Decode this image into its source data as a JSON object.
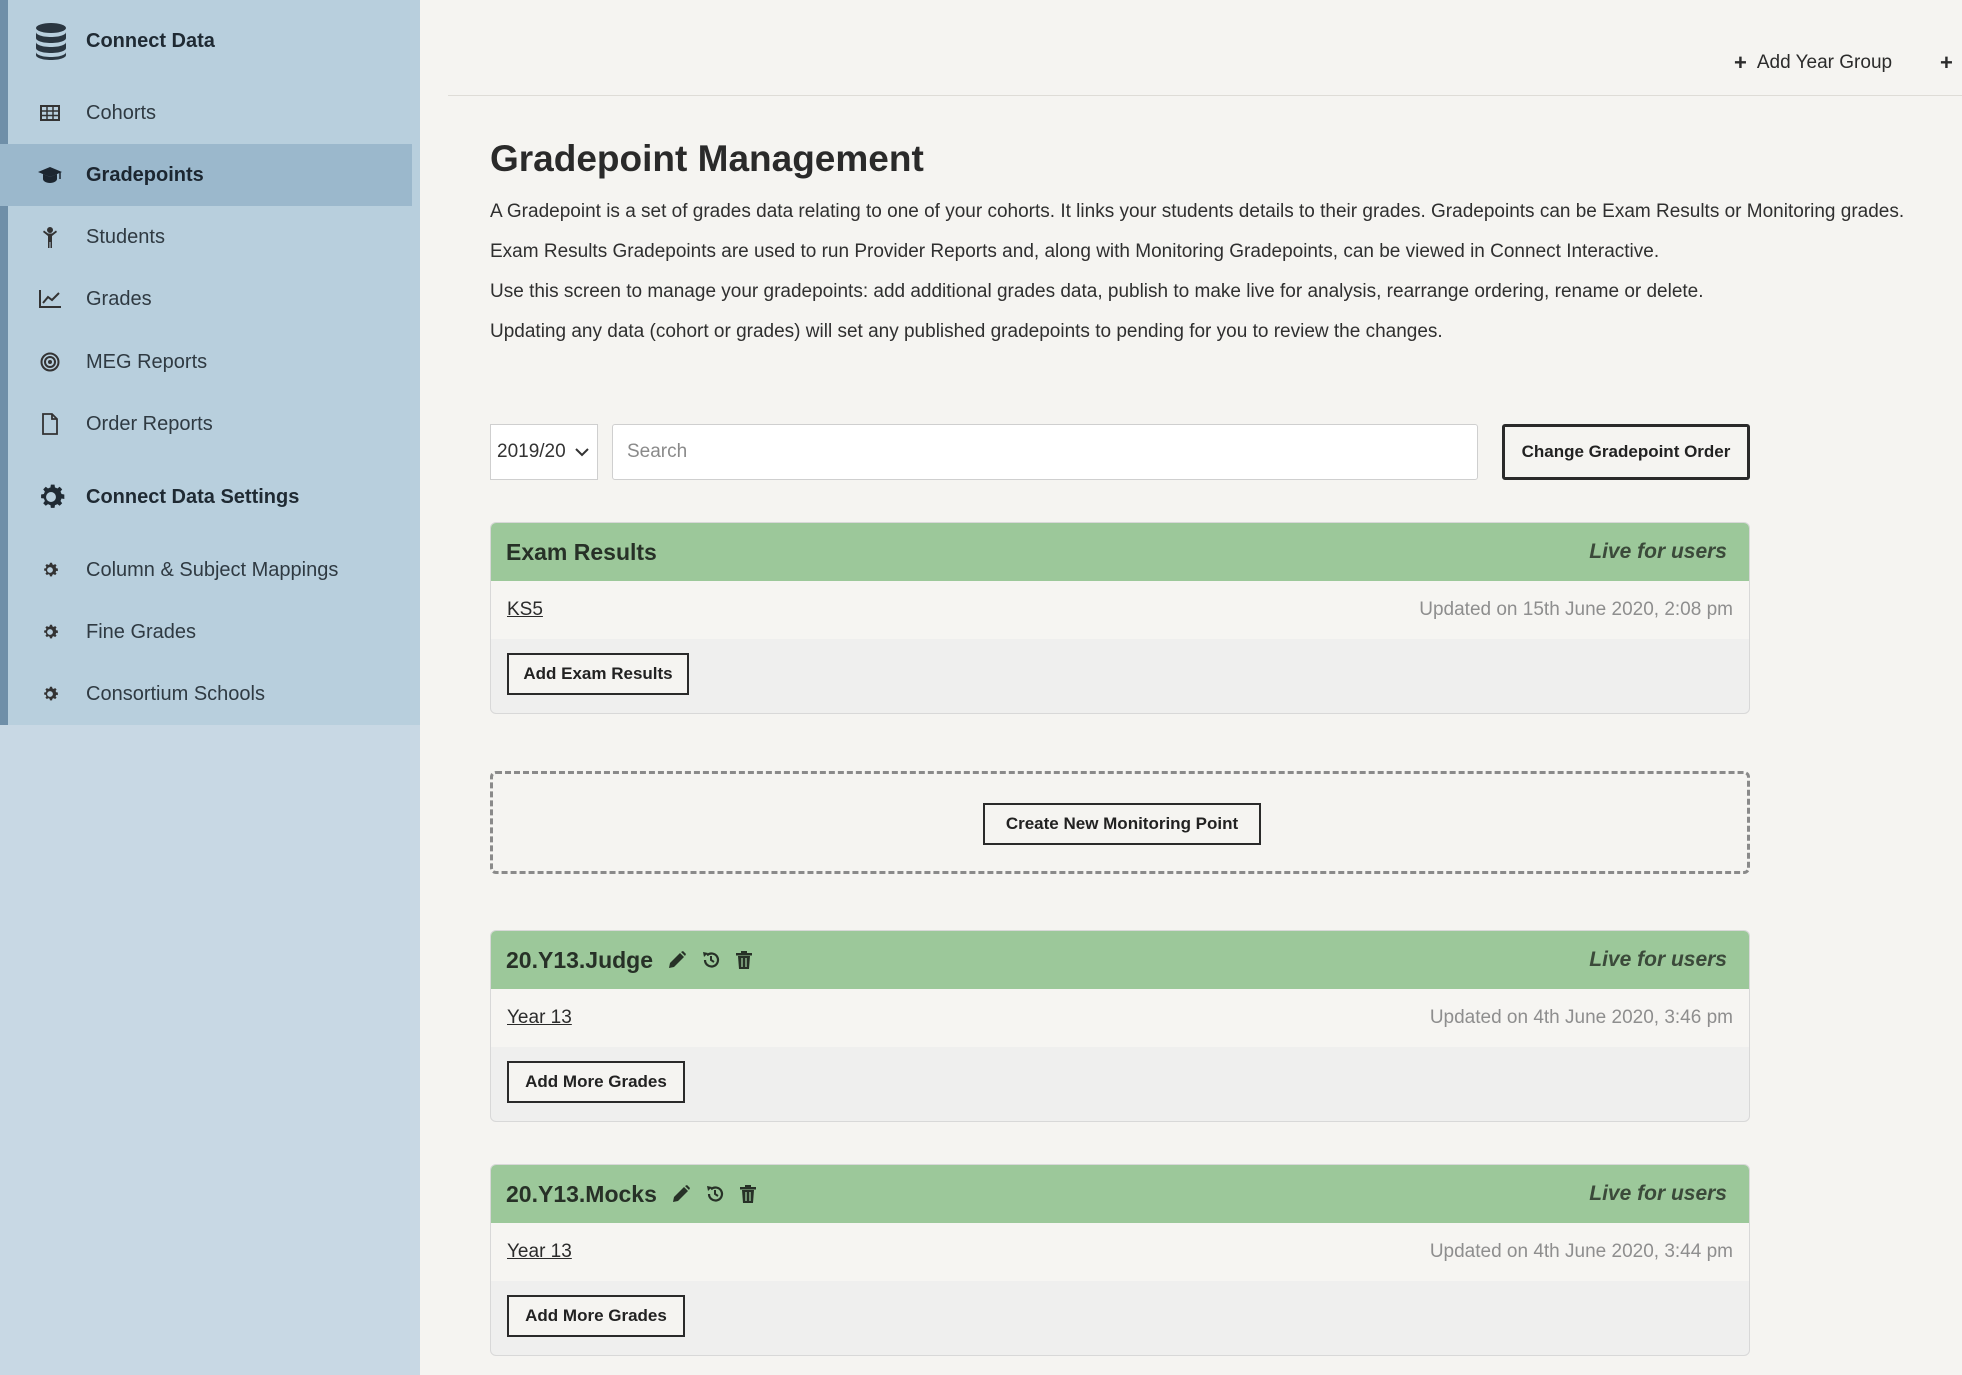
{
  "sidebar": {
    "heading_main": "Connect Data",
    "items": [
      {
        "label": "Cohorts",
        "icon": "table-icon"
      },
      {
        "label": "Gradepoints",
        "icon": "graduation-cap-icon"
      },
      {
        "label": "Students",
        "icon": "child-icon"
      },
      {
        "label": "Grades",
        "icon": "line-chart-icon"
      },
      {
        "label": "MEG Reports",
        "icon": "bullseye-icon"
      },
      {
        "label": "Order Reports",
        "icon": "file-icon"
      }
    ],
    "heading_settings": "Connect Data Settings",
    "settings_items": [
      {
        "label": "Column & Subject Mappings",
        "icon": "cog-icon"
      },
      {
        "label": "Fine Grades",
        "icon": "cog-icon"
      },
      {
        "label": "Consortium Schools",
        "icon": "cog-icon"
      }
    ]
  },
  "topbar": {
    "add_year_group": "Add Year Group",
    "plus_symbol": "+"
  },
  "page": {
    "title": "Gradepoint Management",
    "intro": [
      "A Gradepoint is a set of grades data relating to one of your cohorts. It links your students details to their grades. Gradepoints can be Exam Results or Monitoring grades.",
      "Exam Results Gradepoints are used to run Provider Reports and, along with Monitoring Gradepoints, can be viewed in Connect Interactive.",
      "Use this screen to manage your gradepoints: add additional grades data, publish to make live for analysis, rearrange ordering, rename or delete.",
      "Updating any data (cohort or grades) will set any published gradepoints to pending for you to review the changes."
    ]
  },
  "filters": {
    "year": "2019/20",
    "search_placeholder": "Search",
    "search_value": "",
    "change_order_label": "Change Gradepoint Order"
  },
  "exam_card": {
    "title": "Exam Results",
    "status": "Live for users",
    "link": "KS5",
    "updated": "Updated on 15th June 2020, 2:08 pm",
    "button": "Add Exam Results"
  },
  "create_monitoring_label": "Create New Monitoring Point",
  "monitoring_cards": [
    {
      "title": "20.Y13.Judge",
      "status": "Live for users",
      "link": "Year 13",
      "updated": "Updated on 4th June 2020, 3:46 pm",
      "button": "Add More Grades"
    },
    {
      "title": "20.Y13.Mocks",
      "status": "Live for users",
      "link": "Year 13",
      "updated": "Updated on 4th June 2020, 3:44 pm",
      "button": "Add More Grades"
    }
  ],
  "colors": {
    "sidebar_bg": "#c8d8e4",
    "sidebar_block": "#b8cfdd",
    "sidebar_active": "#9bb8cc",
    "card_header": "#9cc89a",
    "page_bg": "#f5f4f1"
  }
}
